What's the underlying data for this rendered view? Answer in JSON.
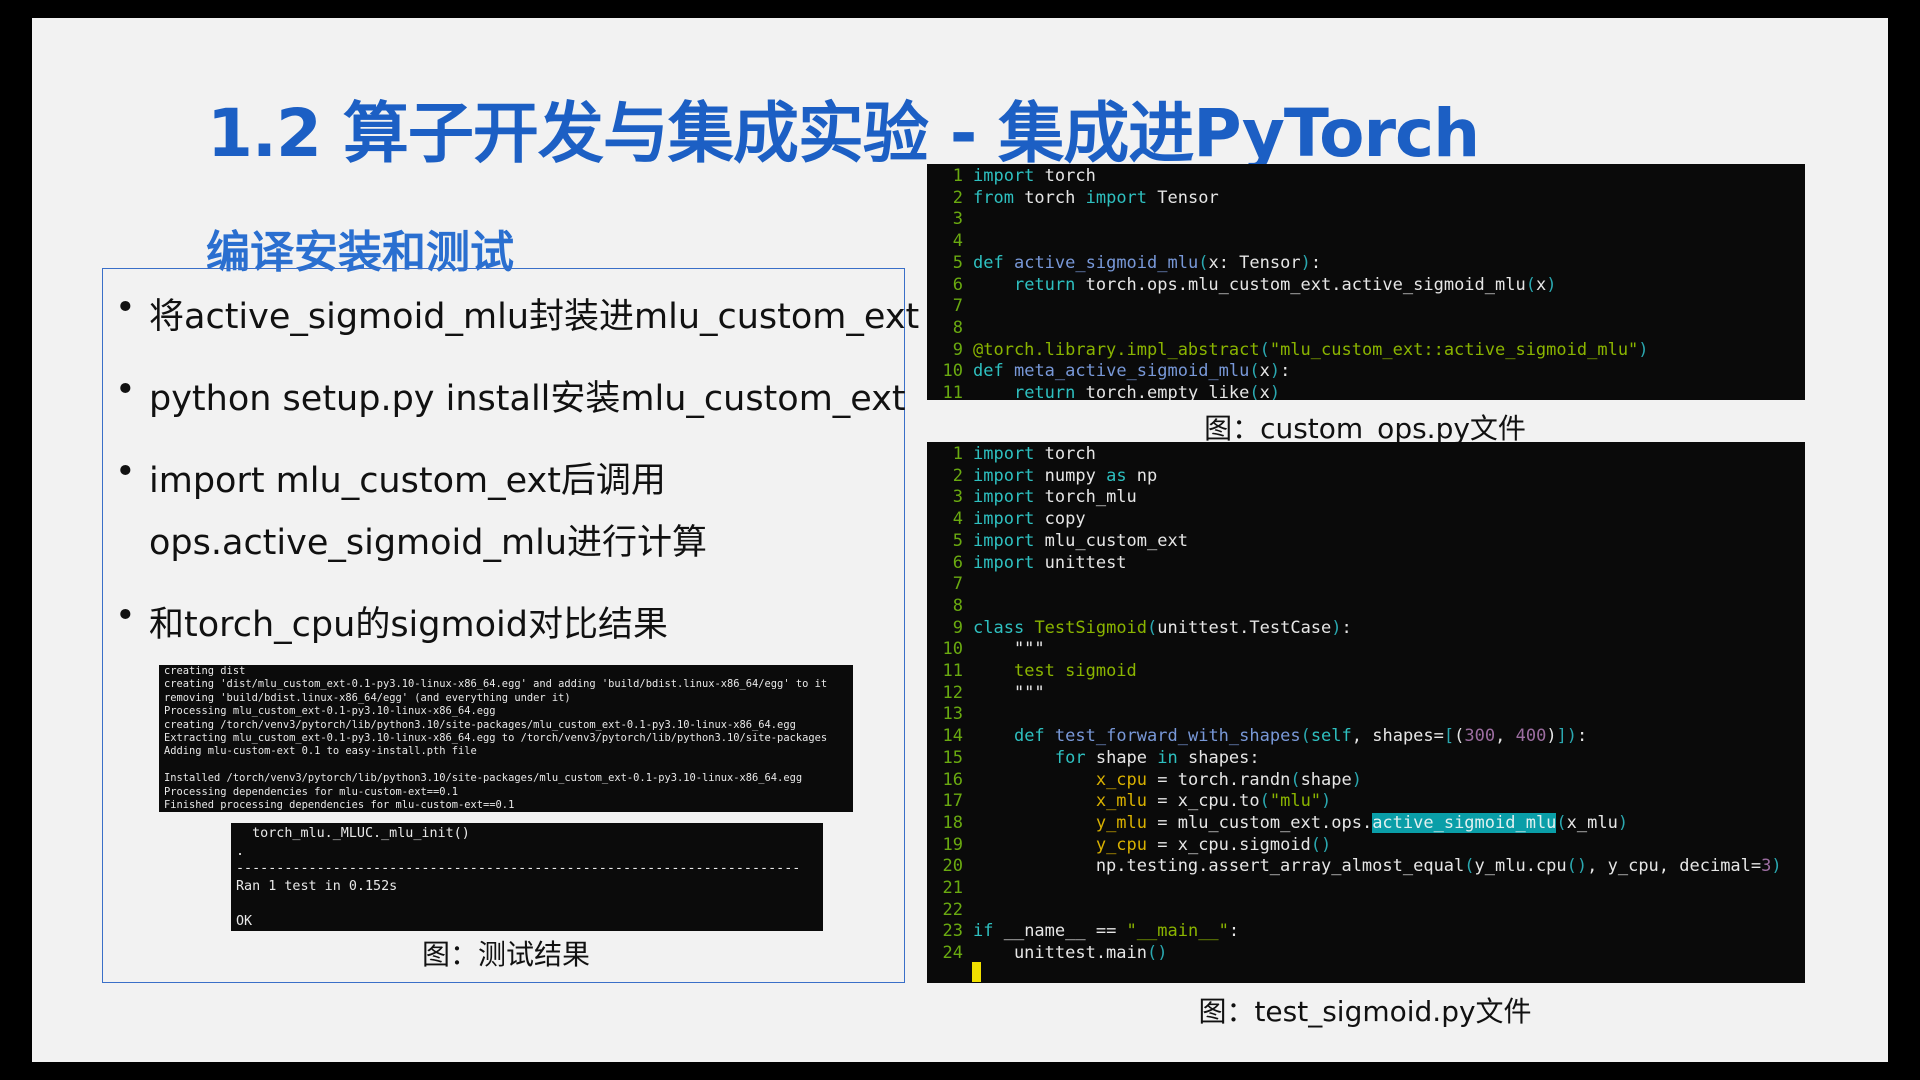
{
  "title": "1.2 算子开发与集成实验 - 集成进PyTorch",
  "subtitle": "编译安装和测试",
  "bullets": [
    "将active_sigmoid_mlu封装进mlu_custom_ext",
    "python setup.py install安装mlu_custom_ext",
    "import mlu_custom_ext后调用",
    "ops.active_sigmoid_mlu进行计算",
    "和torch_cpu的sigmoid对比结果"
  ],
  "bullet_symbol": "•",
  "install_log": [
    "creating dist",
    "creating 'dist/mlu_custom_ext-0.1-py3.10-linux-x86_64.egg' and adding 'build/bdist.linux-x86_64/egg' to it",
    "removing 'build/bdist.linux-x86_64/egg' (and everything under it)",
    "Processing mlu_custom_ext-0.1-py3.10-linux-x86_64.egg",
    "creating /torch/venv3/pytorch/lib/python3.10/site-packages/mlu_custom_ext-0.1-py3.10-linux-x86_64.egg",
    "Extracting mlu_custom_ext-0.1-py3.10-linux-x86_64.egg to /torch/venv3/pytorch/lib/python3.10/site-packages",
    "Adding mlu-custom-ext 0.1 to easy-install.pth file",
    "",
    "Installed /torch/venv3/pytorch/lib/python3.10/site-packages/mlu_custom_ext-0.1-py3.10-linux-x86_64.egg",
    "Processing dependencies for mlu-custom-ext==0.1",
    "Finished processing dependencies for mlu-custom-ext==0.1"
  ],
  "test_log": [
    "  torch_mlu._MLUC._mlu_init()",
    ".",
    "----------------------------------------------------------------------",
    "Ran 1 test in 0.152s",
    "",
    "OK"
  ],
  "caption_test": "图：测试结果",
  "caption_custom_ops": "图：custom_ops.py文件",
  "caption_test_sigmoid": "图：test_sigmoid.py文件",
  "colors": {
    "title": "#1c5fc4",
    "keyword": "#2ec0c0",
    "function": "#7898d8",
    "string": "#8ab400",
    "variable": "#d8b000",
    "number": "#9c6da0",
    "highlight": "#0a9ea8",
    "line_number": "#6aaa10"
  },
  "custom_ops_code": [
    [
      [
        "import",
        "kw"
      ],
      [
        " torch",
        "plain"
      ]
    ],
    [
      [
        "from",
        "kw"
      ],
      [
        " torch ",
        "plain"
      ],
      [
        "import",
        "kw"
      ],
      [
        " Tensor",
        "plain"
      ]
    ],
    [],
    [],
    [
      [
        "def",
        "kw"
      ],
      [
        " ",
        "plain"
      ],
      [
        "active_sigmoid_mlu",
        "fn"
      ],
      [
        "(",
        "paren"
      ],
      [
        "x: Tensor",
        "plain"
      ],
      [
        ")",
        "paren"
      ],
      [
        ":",
        "plain"
      ]
    ],
    [
      [
        "    ",
        "plain"
      ],
      [
        "return",
        "kw"
      ],
      [
        " torch.ops.mlu_custom_ext.active_sigmoid_mlu",
        "plain"
      ],
      [
        "(",
        "paren"
      ],
      [
        "x",
        "plain"
      ],
      [
        ")",
        "paren"
      ]
    ],
    [],
    [],
    [
      [
        "@torch.library.impl_abstract",
        "deco"
      ],
      [
        "(",
        "paren"
      ],
      [
        "\"mlu_custom_ext::active_sigmoid_mlu\"",
        "str"
      ],
      [
        ")",
        "paren"
      ]
    ],
    [
      [
        "def",
        "kw"
      ],
      [
        " ",
        "plain"
      ],
      [
        "meta_active_sigmoid_mlu",
        "fn"
      ],
      [
        "(",
        "paren"
      ],
      [
        "x",
        "plain"
      ],
      [
        ")",
        "paren"
      ],
      [
        ":",
        "plain"
      ]
    ],
    [
      [
        "    ",
        "plain"
      ],
      [
        "return",
        "kw"
      ],
      [
        " torch.empty_like",
        "plain"
      ],
      [
        "(",
        "paren"
      ],
      [
        "x",
        "plain"
      ],
      [
        ")",
        "paren"
      ]
    ]
  ],
  "test_sigmoid_code": [
    [
      [
        "import",
        "kw"
      ],
      [
        " torch",
        "plain"
      ]
    ],
    [
      [
        "import",
        "kw"
      ],
      [
        " numpy ",
        "plain"
      ],
      [
        "as",
        "kw"
      ],
      [
        " np",
        "plain"
      ]
    ],
    [
      [
        "import",
        "kw"
      ],
      [
        " torch_mlu",
        "plain"
      ]
    ],
    [
      [
        "import",
        "kw"
      ],
      [
        " copy",
        "plain"
      ]
    ],
    [
      [
        "import",
        "kw"
      ],
      [
        " mlu_custom_ext",
        "plain"
      ]
    ],
    [
      [
        "import",
        "kw"
      ],
      [
        " unittest",
        "plain"
      ]
    ],
    [],
    [],
    [
      [
        "class",
        "kw"
      ],
      [
        " ",
        "plain"
      ],
      [
        "TestSigmoid",
        "str"
      ],
      [
        "(",
        "paren"
      ],
      [
        "unittest.TestCase",
        "plain"
      ],
      [
        ")",
        "paren"
      ],
      [
        ":",
        "plain"
      ]
    ],
    [
      [
        "    \"\"\"",
        "plain"
      ]
    ],
    [
      [
        "    ",
        "plain"
      ],
      [
        "test sigmoid",
        "str"
      ]
    ],
    [
      [
        "    \"\"\"",
        "plain"
      ]
    ],
    [],
    [
      [
        "    ",
        "plain"
      ],
      [
        "def",
        "kw"
      ],
      [
        " ",
        "plain"
      ],
      [
        "test_forward_with_shapes",
        "fn"
      ],
      [
        "(",
        "paren"
      ],
      [
        "self",
        "kw"
      ],
      [
        ", shapes=",
        "plain"
      ],
      [
        "[",
        "paren"
      ],
      [
        "(",
        "plain"
      ],
      [
        "300",
        "num"
      ],
      [
        ", ",
        "plain"
      ],
      [
        "400",
        "num"
      ],
      [
        ")",
        "plain"
      ],
      [
        "])",
        "paren"
      ],
      [
        ":",
        "plain"
      ]
    ],
    [
      [
        "        ",
        "plain"
      ],
      [
        "for",
        "kw"
      ],
      [
        " shape ",
        "plain"
      ],
      [
        "in",
        "kw"
      ],
      [
        " shapes:",
        "plain"
      ]
    ],
    [
      [
        "            ",
        "plain"
      ],
      [
        "x_cpu",
        "var"
      ],
      [
        " = torch.randn",
        "plain"
      ],
      [
        "(",
        "paren"
      ],
      [
        "shape",
        "plain"
      ],
      [
        ")",
        "paren"
      ]
    ],
    [
      [
        "            ",
        "plain"
      ],
      [
        "x_mlu",
        "var"
      ],
      [
        " = x_cpu.to",
        "plain"
      ],
      [
        "(",
        "paren"
      ],
      [
        "\"mlu\"",
        "str"
      ],
      [
        ")",
        "paren"
      ]
    ],
    [
      [
        "            ",
        "plain"
      ],
      [
        "y_mlu",
        "var"
      ],
      [
        " = mlu_custom_ext.ops.",
        "plain"
      ],
      [
        "active_sigmoid_mlu",
        "hl"
      ],
      [
        "(",
        "paren"
      ],
      [
        "x_mlu",
        "plain"
      ],
      [
        ")",
        "paren"
      ]
    ],
    [
      [
        "            ",
        "plain"
      ],
      [
        "y_cpu",
        "var"
      ],
      [
        " = x_cpu.sigmoid",
        "plain"
      ],
      [
        "()",
        "paren"
      ]
    ],
    [
      [
        "            np.testing.assert_array_almost_equal",
        "plain"
      ],
      [
        "(",
        "paren"
      ],
      [
        "y_mlu.cpu",
        "plain"
      ],
      [
        "()",
        "paren"
      ],
      [
        ", y_cpu, decimal=",
        "plain"
      ],
      [
        "3",
        "num"
      ],
      [
        ")",
        "paren"
      ]
    ],
    [],
    [],
    [
      [
        "if",
        "kw"
      ],
      [
        " __name__ == ",
        "plain"
      ],
      [
        "\"__main__\"",
        "str"
      ],
      [
        ":",
        "plain"
      ]
    ],
    [
      [
        "    unittest.main",
        "plain"
      ],
      [
        "()",
        "paren"
      ]
    ]
  ]
}
